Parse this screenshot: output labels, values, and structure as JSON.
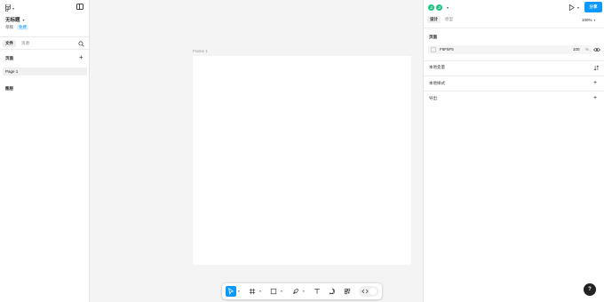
{
  "left_panel": {
    "file_title": "无标题",
    "meta_primary": "草稿",
    "meta_badge": "免费",
    "tabs": {
      "file": "文件",
      "assets": "资源"
    },
    "pages_heading": "页面",
    "pages": [
      {
        "label": "Page 1"
      }
    ],
    "layers_heading": "图层"
  },
  "canvas": {
    "frame_label": "Frame 1",
    "background_color": "#f4f4f4",
    "frame_color": "#ffffff"
  },
  "toolbar": {
    "tools": [
      {
        "name": "move",
        "icon": "cursor-icon",
        "active": true
      },
      {
        "name": "frame",
        "icon": "frame-icon"
      },
      {
        "name": "shape",
        "icon": "rectangle-icon"
      },
      {
        "name": "pen",
        "icon": "pen-icon"
      },
      {
        "name": "text",
        "icon": "text-icon"
      },
      {
        "name": "comment",
        "icon": "comment-icon"
      },
      {
        "name": "actions",
        "icon": "actions-icon"
      },
      {
        "name": "dev-mode",
        "icon": "code-icon"
      }
    ]
  },
  "right_panel": {
    "avatars": [
      "J",
      "J"
    ],
    "share_label": "分享",
    "tabs": {
      "design": "设计",
      "prototype": "原型"
    },
    "zoom": "100%",
    "page_section": {
      "heading": "页面",
      "bg_hex": "F5F5F5",
      "opacity": "100",
      "opacity_unit": "%"
    },
    "sections": [
      {
        "label": "本地变量"
      },
      {
        "label": "本地样式"
      },
      {
        "label": "导出"
      }
    ],
    "help_label": "?"
  },
  "colors": {
    "accent": "#0d99ff",
    "avatar": "#1bc47d",
    "panel": "#ffffff",
    "border": "#e3e3e3"
  }
}
